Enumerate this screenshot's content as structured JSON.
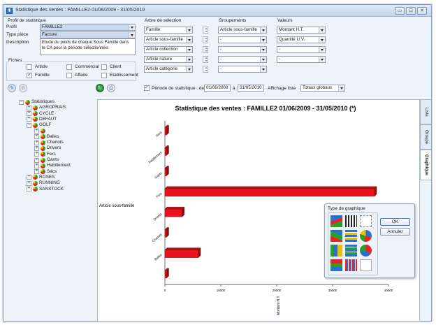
{
  "window": {
    "title": "Statistique des ventes : FAMILLE2 01/06/2009 - 31/05/2010",
    "app_icon": "stats-icon"
  },
  "profil": {
    "section_label": "Profil de statistique",
    "profil_label": "Profil",
    "profil_value": "FAMILLE2",
    "type_label": "Type pièce",
    "type_value": "Facture",
    "description_label": "Description",
    "description_value": "Etude du poids de chaque Sous Famille dans le CA pour la période sélectionnée."
  },
  "fiches": {
    "label": "Fiches",
    "items": [
      {
        "label": "Article",
        "checked": false
      },
      {
        "label": "Commercial",
        "checked": false
      },
      {
        "label": "Client",
        "checked": false
      },
      {
        "label": "Famille",
        "checked": true
      },
      {
        "label": "Affaire",
        "checked": false
      },
      {
        "label": "Etablissement",
        "checked": false
      }
    ]
  },
  "arbre": {
    "label": "Arbre de sélection",
    "items": [
      "Famille",
      "Article sous-famille",
      "Article collection",
      "Article nature",
      "Article catégorie"
    ]
  },
  "groupements": {
    "label": "Groupements",
    "items": [
      "Article sous-famille",
      "-",
      "-",
      "-",
      "-"
    ]
  },
  "valeurs": {
    "label": "Valeurs",
    "items": [
      "Montant H.T.",
      "Quantité U.V.",
      "-",
      "-"
    ]
  },
  "periode": {
    "checked": true,
    "label": "Période de statistique : de",
    "from": "01/06/2009",
    "a_label": "à",
    "to": "31/05/2010"
  },
  "affichage": {
    "label": "Affichage liste",
    "value": "Totaux globaux"
  },
  "tree": {
    "items": [
      {
        "label": "Statistiques",
        "level": 0,
        "expander": "⊟"
      },
      {
        "label": "AGROPRAIS",
        "level": 1,
        "expander": "+"
      },
      {
        "label": "CYCLE",
        "level": 1,
        "expander": "+"
      },
      {
        "label": "DEFAUT",
        "level": 1,
        "expander": "+"
      },
      {
        "label": "GOLF",
        "level": 1,
        "expander": "−"
      },
      {
        "label": "",
        "level": 2,
        "expander": "+"
      },
      {
        "label": "Balles",
        "level": 2,
        "expander": "+"
      },
      {
        "label": "Chariots",
        "level": 2,
        "expander": "+"
      },
      {
        "label": "Drivers",
        "level": 2,
        "expander": "+"
      },
      {
        "label": "Fers",
        "level": 2,
        "expander": "+"
      },
      {
        "label": "Gants",
        "level": 2,
        "expander": "+"
      },
      {
        "label": "Habillement",
        "level": 2,
        "expander": "+"
      },
      {
        "label": "Sacs",
        "level": 2,
        "expander": "+"
      },
      {
        "label": "ROSES",
        "level": 1,
        "expander": "+"
      },
      {
        "label": "RUNNING",
        "level": 1,
        "expander": "+"
      },
      {
        "label": "SANSTOCK",
        "level": 1,
        "expander": "+"
      }
    ]
  },
  "side_tabs": [
    "Liste",
    "Groupe",
    "Graphique"
  ],
  "chart_data": {
    "type": "bar",
    "orientation": "horizontal",
    "title": "Statistique des ventes  : FAMILLE2 01/06/2009 - 31/05/2010 (*)",
    "ylabel": "Article sous-famille",
    "xlabel": "Montant H.T.",
    "categories": [
      "Sacs",
      "Habillement",
      "Gants",
      "Fers",
      "Drivers",
      "Chariots",
      "Balles",
      ""
    ],
    "values": [
      0,
      0,
      0,
      37500,
      3100,
      0,
      6000,
      0
    ],
    "xlim": [
      0,
      40000
    ],
    "ticks": [
      "0",
      "10000",
      "20000",
      "30000",
      "40000"
    ],
    "bar_color": "#e8141b"
  },
  "popup": {
    "title": "Type de graphique",
    "ok": "OK",
    "cancel": "Annuler"
  }
}
